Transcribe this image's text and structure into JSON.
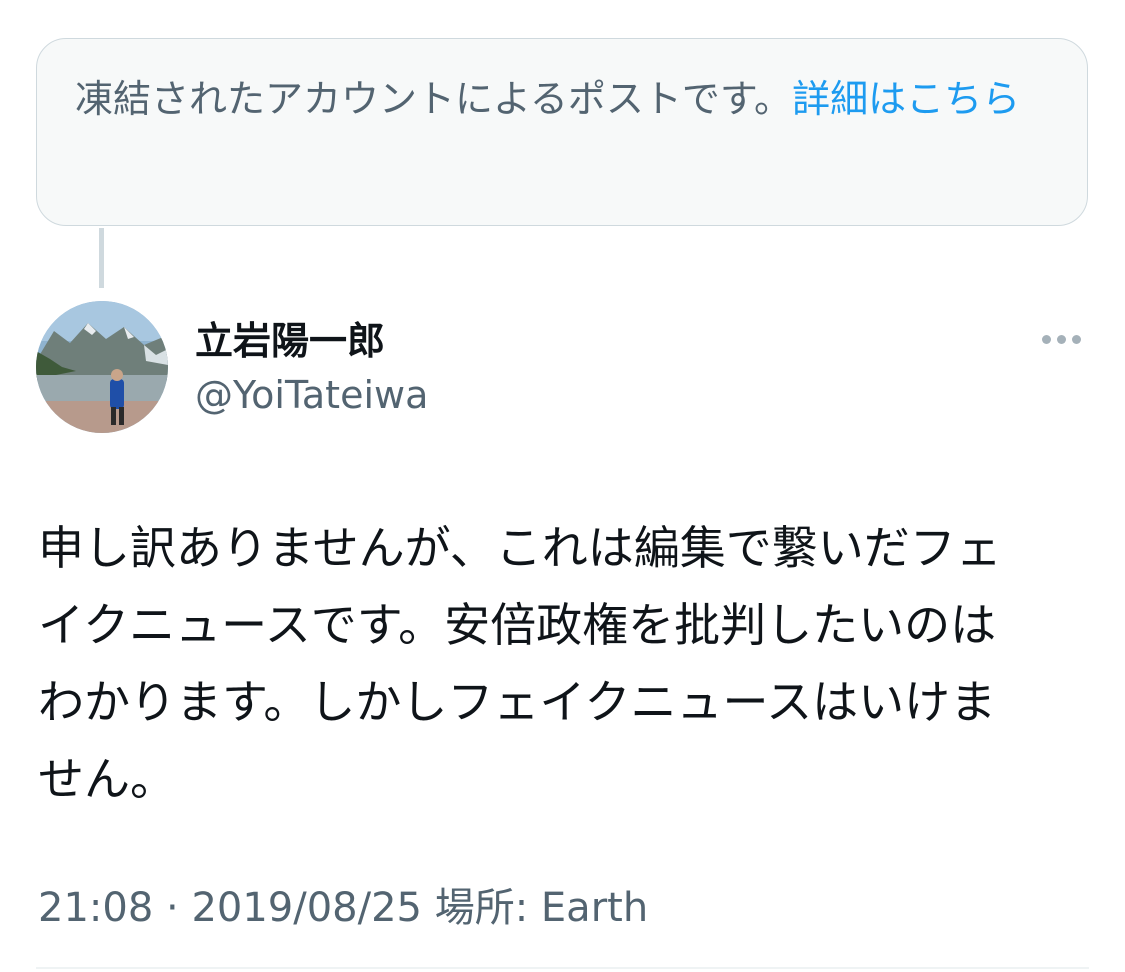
{
  "notice": {
    "text": "凍結されたアカウントによるポストです。",
    "link_label": "詳細はこちら"
  },
  "author": {
    "display_name": "立岩陽一郎",
    "handle": "@YoiTateiwa",
    "avatar_icon": "profile-photo-mountain-lake"
  },
  "more_icon": "more-options-icon",
  "tweet": {
    "text": "申し訳ありませんが、これは編集で繋いだフェイクニュースです。安倍政権を批判したいのはわかります。しかしフェイクニュースはいけません。"
  },
  "meta": {
    "time": "21:08",
    "separator": "·",
    "date": "2019/08/25",
    "location_label": "場所:",
    "location": "Earth"
  },
  "colors": {
    "link": "#1d9bf0",
    "secondary_text": "#536471",
    "notice_background": "#f7f9f9",
    "border": "#cfd9de"
  }
}
